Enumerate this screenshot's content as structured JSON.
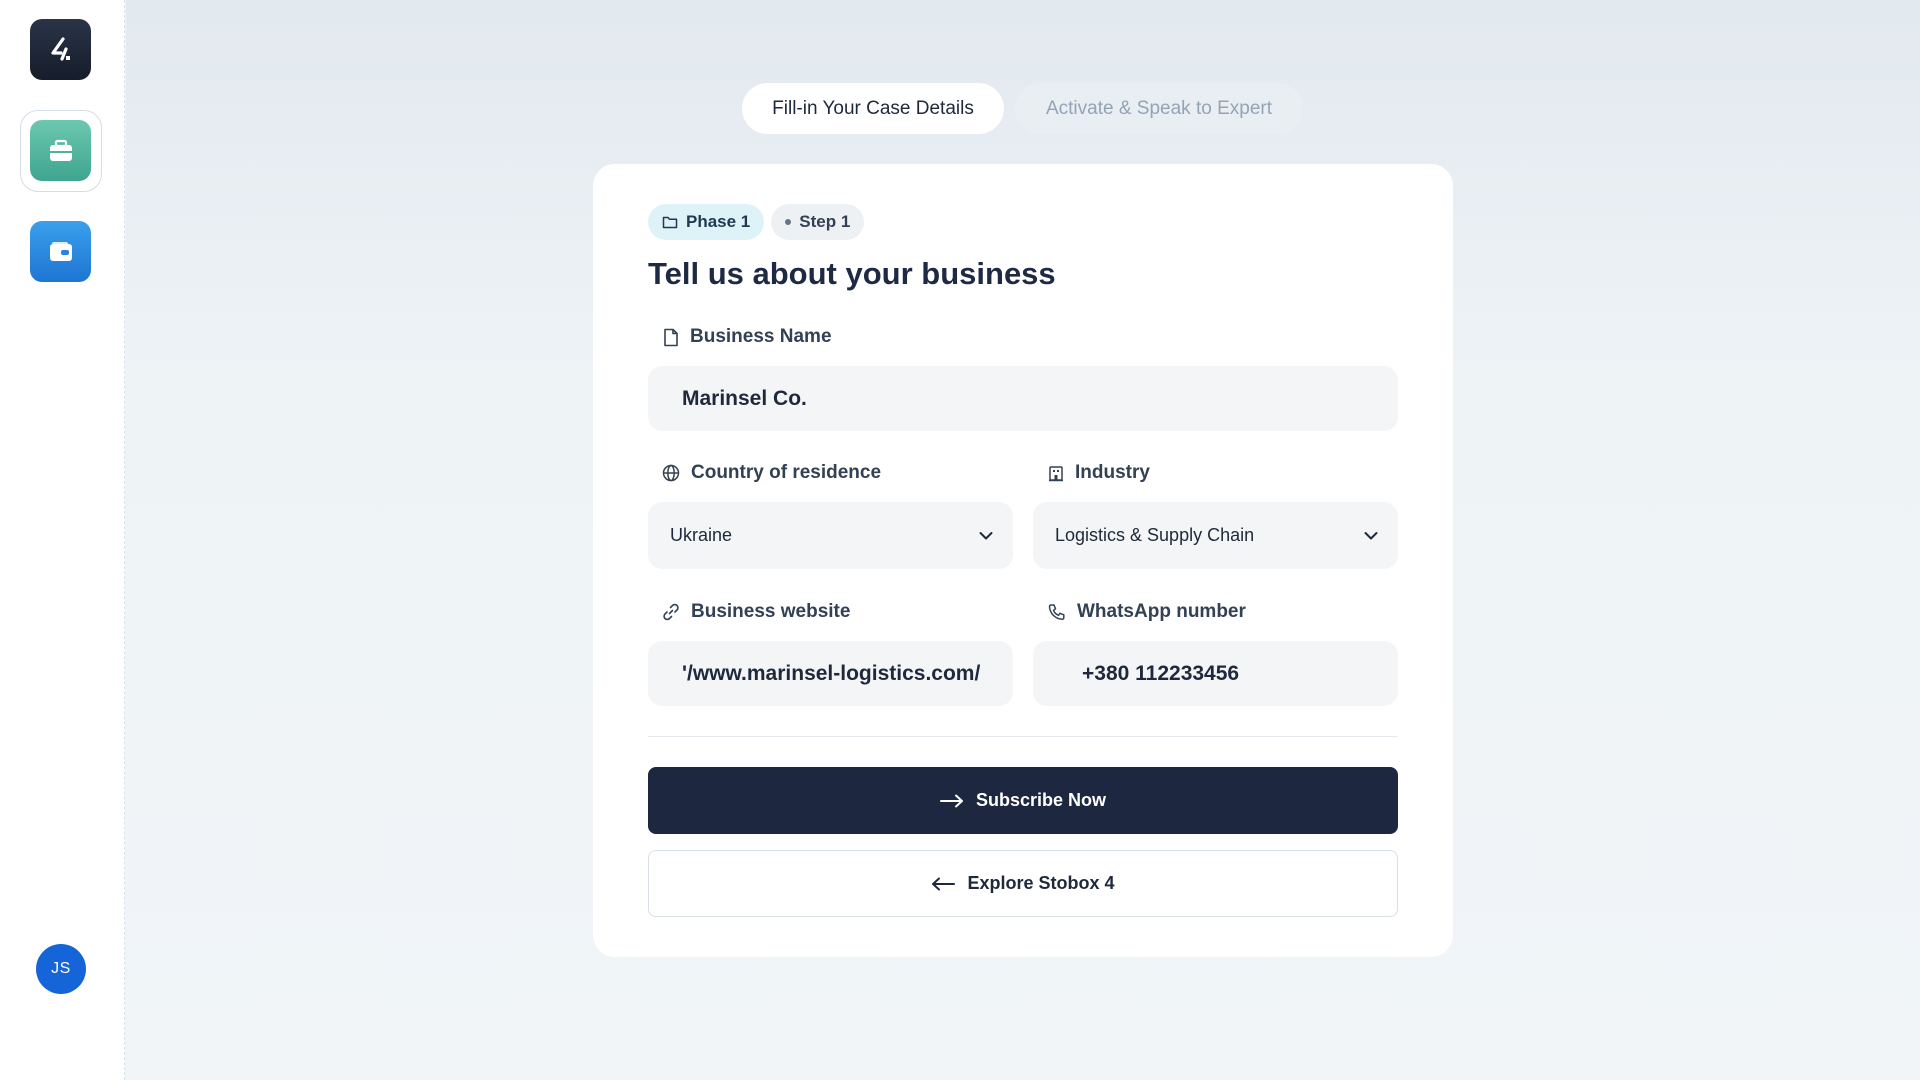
{
  "sidebar": {
    "logo_icon": "stobox-logo-icon",
    "items": [
      {
        "icon": "briefcase-icon"
      },
      {
        "icon": "wallet-icon"
      }
    ],
    "avatar_initials": "JS"
  },
  "tabs": [
    {
      "label": "Fill-in Your Case Details",
      "active": true
    },
    {
      "label": "Activate & Speak to Expert",
      "active": false
    }
  ],
  "form": {
    "phase_label": "Phase 1",
    "step_label": "Step 1",
    "title": "Tell us about your business",
    "business_name": {
      "label": "Business Name",
      "value": "Marinsel Co."
    },
    "country": {
      "label": "Country of residence",
      "value": "Ukraine"
    },
    "industry": {
      "label": "Industry",
      "value": "Logistics & Supply Chain"
    },
    "website": {
      "label": "Business website",
      "value": "'/www.marinsel-logistics.com/"
    },
    "whatsapp": {
      "label": "WhatsApp number",
      "value": "+380 112233456"
    },
    "subscribe_label": "Subscribe Now",
    "explore_label": "Explore Stobox 4"
  },
  "colors": {
    "primary": "#1e2740",
    "accent_teal": "#3fa58f",
    "accent_blue": "#1e75d3",
    "avatar": "#1565d8"
  }
}
